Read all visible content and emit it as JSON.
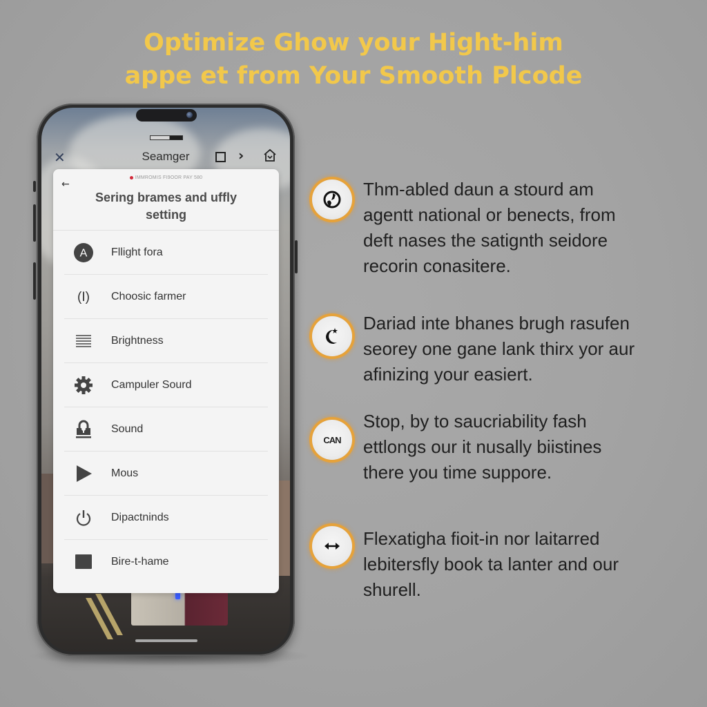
{
  "headline": {
    "line1": "Optimize Ghow your Hight-him",
    "line2": "appe et from Your Smooth Plcode",
    "color": "#f2c84b"
  },
  "phone": {
    "nav": {
      "close_icon": "close-icon",
      "title": "Seamger",
      "icons": [
        "square-icon",
        "chevron-right-icon",
        "home-icon"
      ]
    },
    "card": {
      "back_icon": "back-arrow-icon",
      "subtitle": "IMMROMIS FI9OOR PAY 580",
      "title_line1": "Sering brames and uffly",
      "title_line2": "setting",
      "items": [
        {
          "label": "Fllight fora",
          "icon": "letter-a-circle-icon"
        },
        {
          "label": "Choosic farmer",
          "icon": "parenthesis-bar-icon"
        },
        {
          "label": "Brightness",
          "icon": "lines-icon"
        },
        {
          "label": "Campuler Sourd",
          "icon": "gear-icon"
        },
        {
          "label": "Sound",
          "icon": "lock-icon"
        },
        {
          "label": "Mous",
          "icon": "play-icon"
        },
        {
          "label": "Dipactninds",
          "icon": "power-icon"
        },
        {
          "label": "Bire-t-hame",
          "icon": "square-filled-icon"
        }
      ]
    }
  },
  "features": [
    {
      "icon": "globe-icon",
      "lines": [
        "Thm-abled daun a stourd am",
        "agentt national or benects, from",
        "deft nases the satignth seidore",
        "recorin conasitere."
      ]
    },
    {
      "icon": "moon-star-icon",
      "lines": [
        "Dariad inte bhanes brugh rasufen",
        "seorey one gane lank thirx yor aur",
        "afinizing your easiert."
      ]
    },
    {
      "icon": "can-logo-icon",
      "badge_text": "CAN",
      "lines": [
        "Stop, by to saucriability fash",
        "ettlongs our it nusally biistines",
        "there you time suppore."
      ]
    },
    {
      "icon": "swap-arrows-icon",
      "lines": [
        "Flexatigha fioit-in nor laitarred",
        "lebitersfly book ta lanter and our",
        "shurell."
      ]
    }
  ],
  "colors": {
    "background": "#a5a5a5",
    "badge_ring": "#e6a23a",
    "text": "#1f1f1f"
  }
}
